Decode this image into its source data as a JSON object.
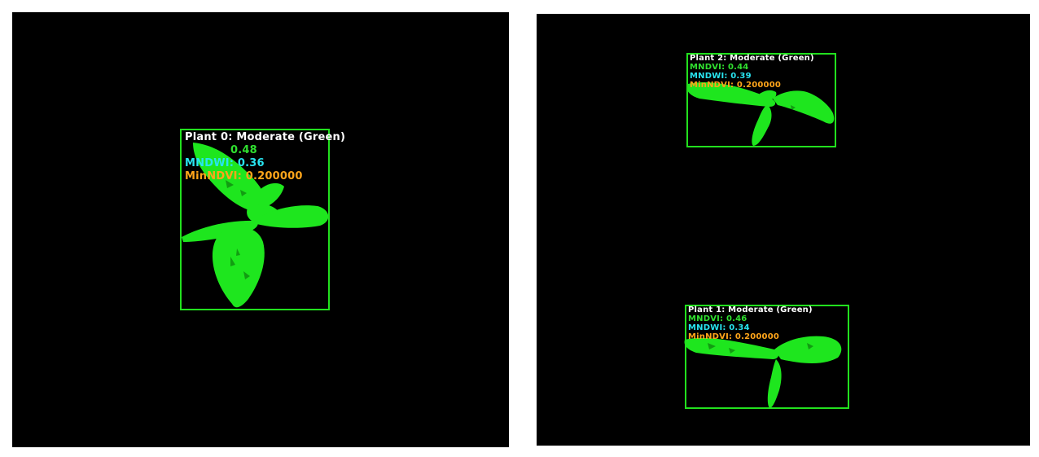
{
  "colors": {
    "background": "#000000",
    "plant": "#1ee61e",
    "bbox": "#22e01e",
    "title_text": "#ffffff",
    "ndvi_text": "#30e030",
    "ndwi_text": "#28e4f0",
    "min_text": "#ffa51a"
  },
  "left_panel": {
    "plants": [
      {
        "title": "Plant 0: Moderate (Green)",
        "ndvi": "0.48",
        "ndwi": "MNDWI: 0.36",
        "min_ndvi": "MinNDVI: 0.200000"
      }
    ]
  },
  "right_panel": {
    "plants": [
      {
        "title": "Plant 2: Moderate (Green)",
        "ndvi": "MNDVI: 0.44",
        "ndwi": "MNDWI: 0.39",
        "min_ndvi": "MinNDVI: 0.200000"
      },
      {
        "title": "Plant 1: Moderate (Green)",
        "ndvi": "MNDVI: 0.46",
        "ndwi": "MNDWI: 0.34",
        "min_ndvi": "MinNDVI: 0.200000"
      }
    ]
  }
}
